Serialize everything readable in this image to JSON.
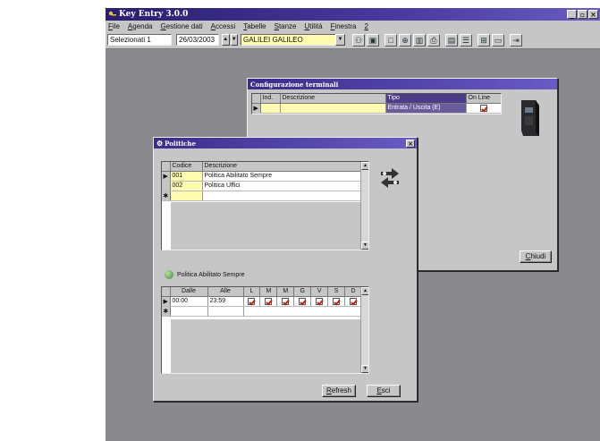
{
  "app": {
    "title": "Key Entry 3.0.0",
    "menu": [
      "File",
      "Agenda",
      "Gestione dati",
      "Accessi",
      "Tabelle",
      "Stanze",
      "Utilità",
      "Finestra",
      "2"
    ]
  },
  "toolbar": {
    "selection_label": "Selezionati 1",
    "date": "26/03/2003",
    "combo_value": "GALILEI GALILEO"
  },
  "config_window": {
    "title": "Configurazione terminali",
    "columns": [
      "Ind.",
      "Descrizione",
      "Tipo",
      "On Line"
    ],
    "row_tipo": "Entrata / Uscita (E)",
    "close_button": "Chiudi"
  },
  "politiche_window": {
    "title": "Politiche",
    "columns": [
      "Codice",
      "Descrizione"
    ],
    "rows": [
      {
        "codice": "001",
        "descrizione": "Politica Abilitato Sempre"
      },
      {
        "codice": "002",
        "descrizione": "Politica Uffici"
      }
    ],
    "selected_policy": "Politica Abilitato Sempre",
    "time_columns": [
      "Dalle",
      "Alle",
      "L",
      "M",
      "M",
      "G",
      "V",
      "S",
      "D"
    ],
    "time_row": {
      "dalle": "00:00",
      "alle": "23:59"
    },
    "refresh_button": "Refresh",
    "exit_button": "Esci"
  },
  "colors": {
    "title_bar": "#3b2c8a",
    "desktop": "#8a8a8e",
    "highlight_yellow": "#fffbb0",
    "check_red": "#c02010"
  }
}
